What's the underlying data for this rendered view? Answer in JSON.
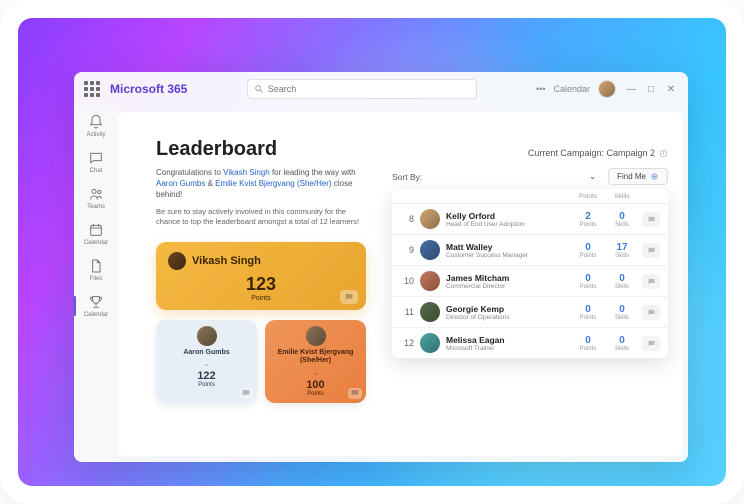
{
  "brand": "Microsoft 365",
  "search": {
    "placeholder": "Search"
  },
  "header": {
    "calendar_label": "Calendar",
    "more": "•••"
  },
  "sidebar": {
    "items": [
      {
        "label": "Activity"
      },
      {
        "label": "Chat"
      },
      {
        "label": "Teams"
      },
      {
        "label": "Calendar"
      },
      {
        "label": "Files"
      },
      {
        "label": "Calendar"
      }
    ]
  },
  "page": {
    "title": "Leaderboard",
    "congrats_pre": "Congratulations to ",
    "leader1": "Vikash Singh",
    "congrats_mid": " for leading the way with ",
    "leader2": "Aaron Gumbs",
    "amp": " & ",
    "leader3": "Emilie Kvist Bjergvang (She/Her)",
    "congrats_post": " close behind!",
    "note": "Be sure to stay actively involved in this community for the chance to top the leaderboard amongst a total of 12 learners!"
  },
  "cards": {
    "primary": {
      "name": "Vikash Singh",
      "points": "123",
      "points_label": "Points"
    },
    "second": {
      "name": "Aaron Gumbs",
      "points": "122",
      "points_label": "Points"
    },
    "third": {
      "name": "Emilie Kvist Bjergvang (She/Her)",
      "points": "100",
      "points_label": "Points"
    }
  },
  "campaign": {
    "label": "Current Campaign: Campaign 2"
  },
  "sort": {
    "label": "Sort By:",
    "findme": "Find Me"
  },
  "table": {
    "col_points": "Points",
    "col_skills": "Skills",
    "rows": [
      {
        "rank": "8",
        "name": "Kelly Orford",
        "role": "Head of End User Adoption",
        "points": "2",
        "skills": "0"
      },
      {
        "rank": "9",
        "name": "Matt Walley",
        "role": "Customer Success Manager",
        "points": "0",
        "skills": "17"
      },
      {
        "rank": "10",
        "name": "James Mitcham",
        "role": "Commercial Director",
        "points": "0",
        "skills": "0"
      },
      {
        "rank": "11",
        "name": "Georgie Kemp",
        "role": "Director of Operations",
        "points": "0",
        "skills": "0"
      },
      {
        "rank": "12",
        "name": "Melissa Eagan",
        "role": "Microsoft Trainer",
        "points": "0",
        "skills": "0"
      }
    ]
  }
}
